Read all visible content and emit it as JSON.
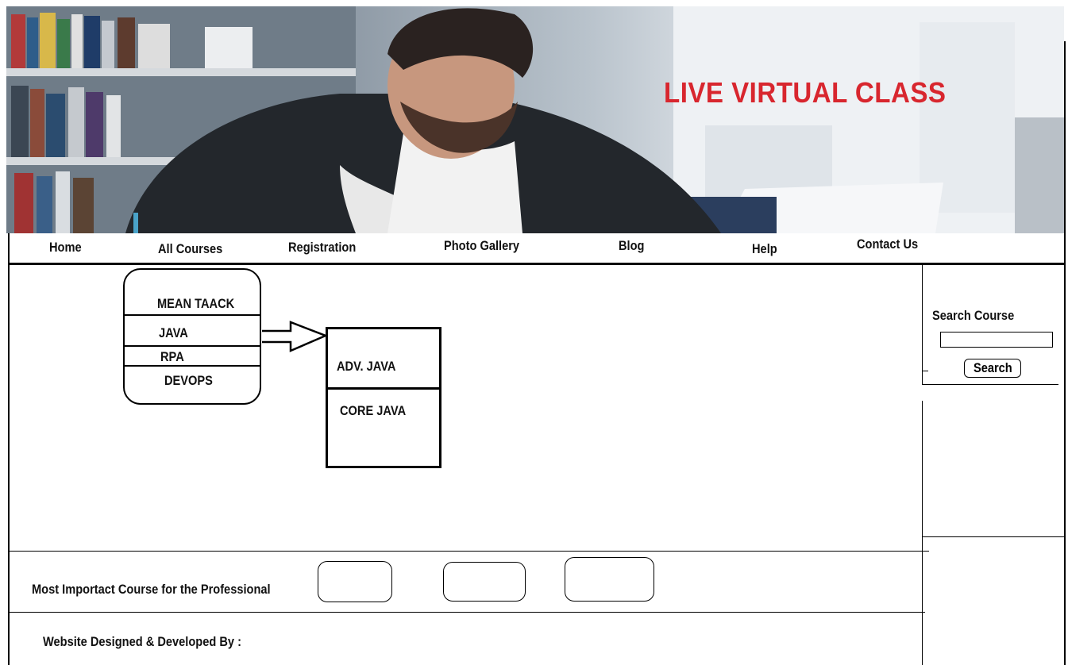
{
  "banner": {
    "title": "LIVE VIRTUAL CLASS"
  },
  "nav": {
    "items": [
      {
        "label": "Home"
      },
      {
        "label": "All Courses"
      },
      {
        "label": "Registration"
      },
      {
        "label": "Photo Gallery"
      },
      {
        "label": "Blog"
      },
      {
        "label": "Help"
      },
      {
        "label": "Contact Us"
      }
    ]
  },
  "courses": {
    "items": [
      "MEAN TAACK",
      "JAVA",
      "RPA",
      "DEVOPS"
    ],
    "submenu": [
      "ADV. JAVA",
      "CORE JAVA"
    ]
  },
  "search": {
    "label": "Search Course",
    "button_label": "Search",
    "value": ""
  },
  "featured": {
    "label": "Most Importact Course for the Professional"
  },
  "footer": {
    "text": "Website Designed & Developed By :"
  },
  "colors": {
    "title_red": "#d8262e"
  }
}
